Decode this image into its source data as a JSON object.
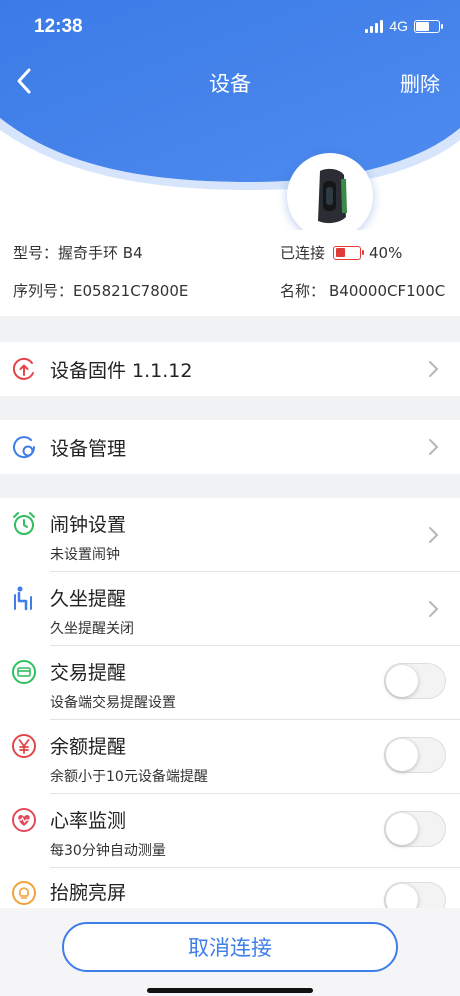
{
  "status_bar": {
    "time": "12:38",
    "network": "4G"
  },
  "nav": {
    "title": "设备",
    "delete_label": "删除"
  },
  "device_info": {
    "model_label": "型号：",
    "model_value": "握奇手环 B4",
    "serial_label": "序列号：",
    "serial_value": "E05821C7800E",
    "connection_status": "已连接",
    "battery_percent": "40%",
    "battery_level": 0.4,
    "name_label": "名称：",
    "name_value": "B40000CF100C"
  },
  "firmware": {
    "title": "设备固件 1.1.12",
    "icon": "firmware-update-icon"
  },
  "management": {
    "title": "设备管理",
    "icon": "device-management-icon"
  },
  "settings": [
    {
      "title": "闹钟设置",
      "subtitle": "未设置闹钟",
      "icon": "alarm-clock-icon",
      "control": "chevron"
    },
    {
      "title": "久坐提醒",
      "subtitle": "久坐提醒关闭",
      "icon": "sitting-person-icon",
      "control": "chevron"
    },
    {
      "title": "交易提醒",
      "subtitle": "设备端交易提醒设置",
      "icon": "transaction-card-icon",
      "control": "toggle",
      "on": false
    },
    {
      "title": "余额提醒",
      "subtitle": "余额小于10元设备端提醒",
      "icon": "yuan-currency-icon",
      "control": "toggle",
      "on": false
    },
    {
      "title": "心率监测",
      "subtitle": "每30分钟自动测量",
      "icon": "heart-rate-icon",
      "control": "toggle",
      "on": false
    },
    {
      "title": "抬腕亮屏",
      "subtitle": "",
      "icon": "lightbulb-icon",
      "control": "toggle",
      "on": false
    }
  ],
  "bottom": {
    "cancel_label": "取消连接"
  },
  "colors": {
    "primary_blue": "#3f7de9",
    "battery_red": "#e03a3a",
    "firmware_red": "#e2454a",
    "green": "#2fbf5f",
    "heart_red": "#e24a5c",
    "bulb_orange": "#f0a33a"
  }
}
